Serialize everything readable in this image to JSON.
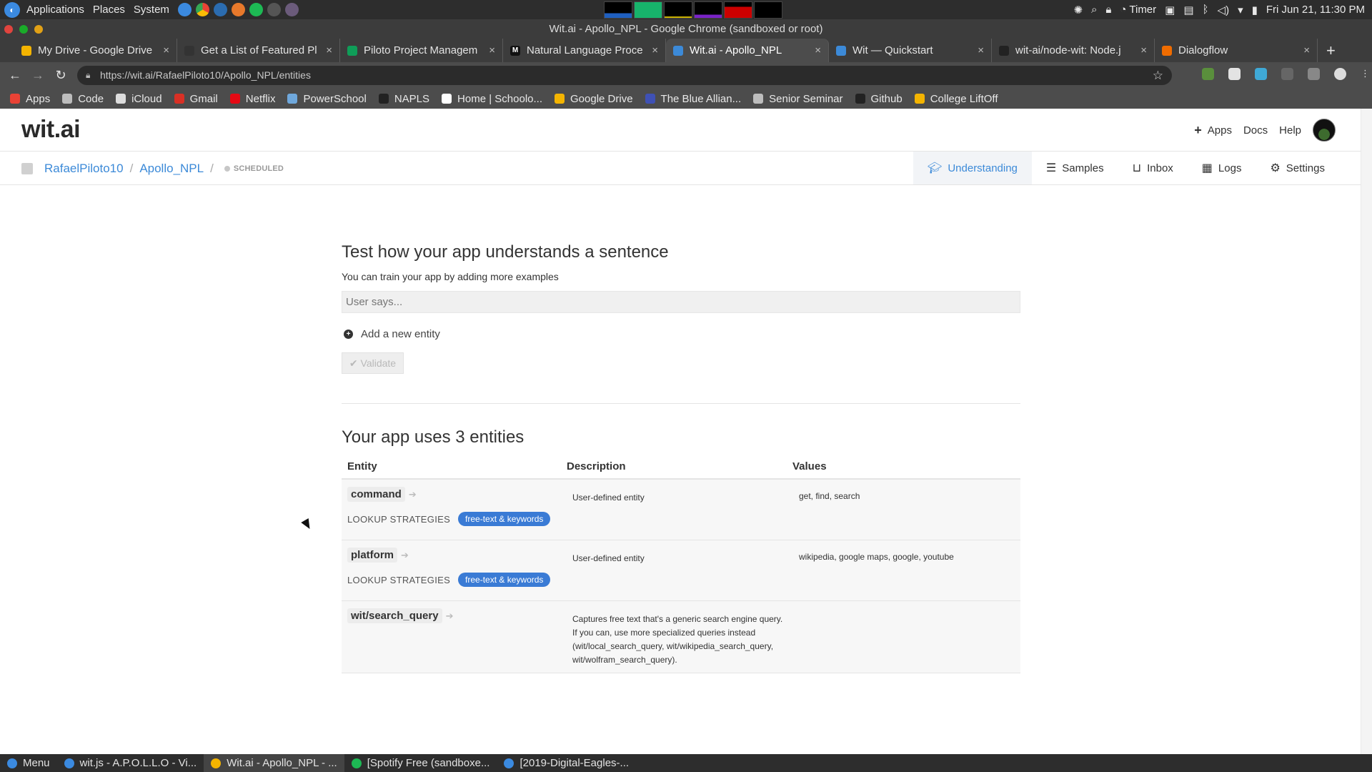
{
  "os": {
    "menus": [
      "Applications",
      "Places",
      "System"
    ],
    "timer_label": "Timer",
    "clock": "Fri Jun 21, 11:30 PM"
  },
  "window": {
    "title": "Wit.ai - Apollo_NPL - Google Chrome (sandboxed or root)"
  },
  "tabs": [
    {
      "label": "My Drive - Google Drive",
      "color": "#f4b400"
    },
    {
      "label": "Get a List of Featured Pl",
      "color": "#333333"
    },
    {
      "label": "Piloto Project Managem",
      "color": "#0f9d58"
    },
    {
      "label": "Natural Language Proce",
      "color": "#111111",
      "glyph": "M"
    },
    {
      "label": "Wit.ai - Apollo_NPL",
      "color": "#3c8ad8",
      "active": true
    },
    {
      "label": "Wit — Quickstart",
      "color": "#3c8ad8"
    },
    {
      "label": "wit-ai/node-wit: Node.j",
      "color": "#222222"
    },
    {
      "label": "Dialogflow",
      "color": "#ef6c00"
    }
  ],
  "url": "https://wit.ai/RafaelPiloto10/Apollo_NPL/entities",
  "bookmarks": [
    {
      "label": "Apps",
      "color": "#e94235"
    },
    {
      "label": "Code",
      "color": "#bdbdbd"
    },
    {
      "label": "iCloud",
      "color": "#dddddd"
    },
    {
      "label": "Gmail",
      "color": "#d93025"
    },
    {
      "label": "Netflix",
      "color": "#e50914"
    },
    {
      "label": "PowerSchool",
      "color": "#6fa8dc"
    },
    {
      "label": "NAPLS",
      "color": "#222222"
    },
    {
      "label": "Home | Schoolo...",
      "color": "#ffffff"
    },
    {
      "label": "Google Drive",
      "color": "#f4b400"
    },
    {
      "label": "The Blue Allian...",
      "color": "#3f51b5"
    },
    {
      "label": "Senior Seminar",
      "color": "#bdbdbd"
    },
    {
      "label": "Github",
      "color": "#222222"
    },
    {
      "label": "College LiftOff",
      "color": "#f4b400"
    }
  ],
  "wit": {
    "logo": "wit.ai",
    "nav": {
      "apps": "Apps",
      "docs": "Docs",
      "help": "Help"
    },
    "breadcrumb": {
      "user": "RafaelPiloto10",
      "app": "Apollo_NPL",
      "status": "SCHEDULED"
    },
    "sections": {
      "understanding": "Understanding",
      "samples": "Samples",
      "inbox": "Inbox",
      "logs": "Logs",
      "settings": "Settings"
    },
    "test": {
      "title": "Test how your app understands a sentence",
      "hint": "You can train your app by adding more examples",
      "placeholder": "User says...",
      "add_entity": "Add a new entity",
      "validate": "Validate"
    },
    "entities_title": "Your app uses 3 entities",
    "table_headers": {
      "entity": "Entity",
      "description": "Description",
      "values": "Values"
    },
    "lookup_label": "LOOKUP STRATEGIES",
    "lookup_pill": "free-text & keywords",
    "entities": [
      {
        "name": "command",
        "description": "User-defined entity",
        "values": "get, find, search"
      },
      {
        "name": "platform",
        "description": "User-defined entity",
        "values": "wikipedia, google maps, google, youtube"
      },
      {
        "name": "wit/search_query",
        "description_lines": [
          "Captures free text that's a generic search engine query.",
          "If you can, use more specialized queries instead",
          "(wit/local_search_query, wit/wikipedia_search_query,",
          "wit/wolfram_search_query)."
        ],
        "values": ""
      }
    ]
  },
  "taskbar": {
    "menu": "Menu",
    "items": [
      {
        "label": "wit.js - A.P.O.L.L.O - Vi...",
        "color": "#3b8ae0"
      },
      {
        "label": "Wit.ai - Apollo_NPL - ...",
        "color": "#f4b400",
        "active": true
      },
      {
        "label": "[Spotify Free (sandboxe...",
        "color": "#1db954"
      },
      {
        "label": "[2019-Digital-Eagles-...",
        "color": "#3b8ae0"
      }
    ]
  },
  "colors": {
    "accent": "#3c8ad8",
    "pill": "#3a7bd5"
  }
}
